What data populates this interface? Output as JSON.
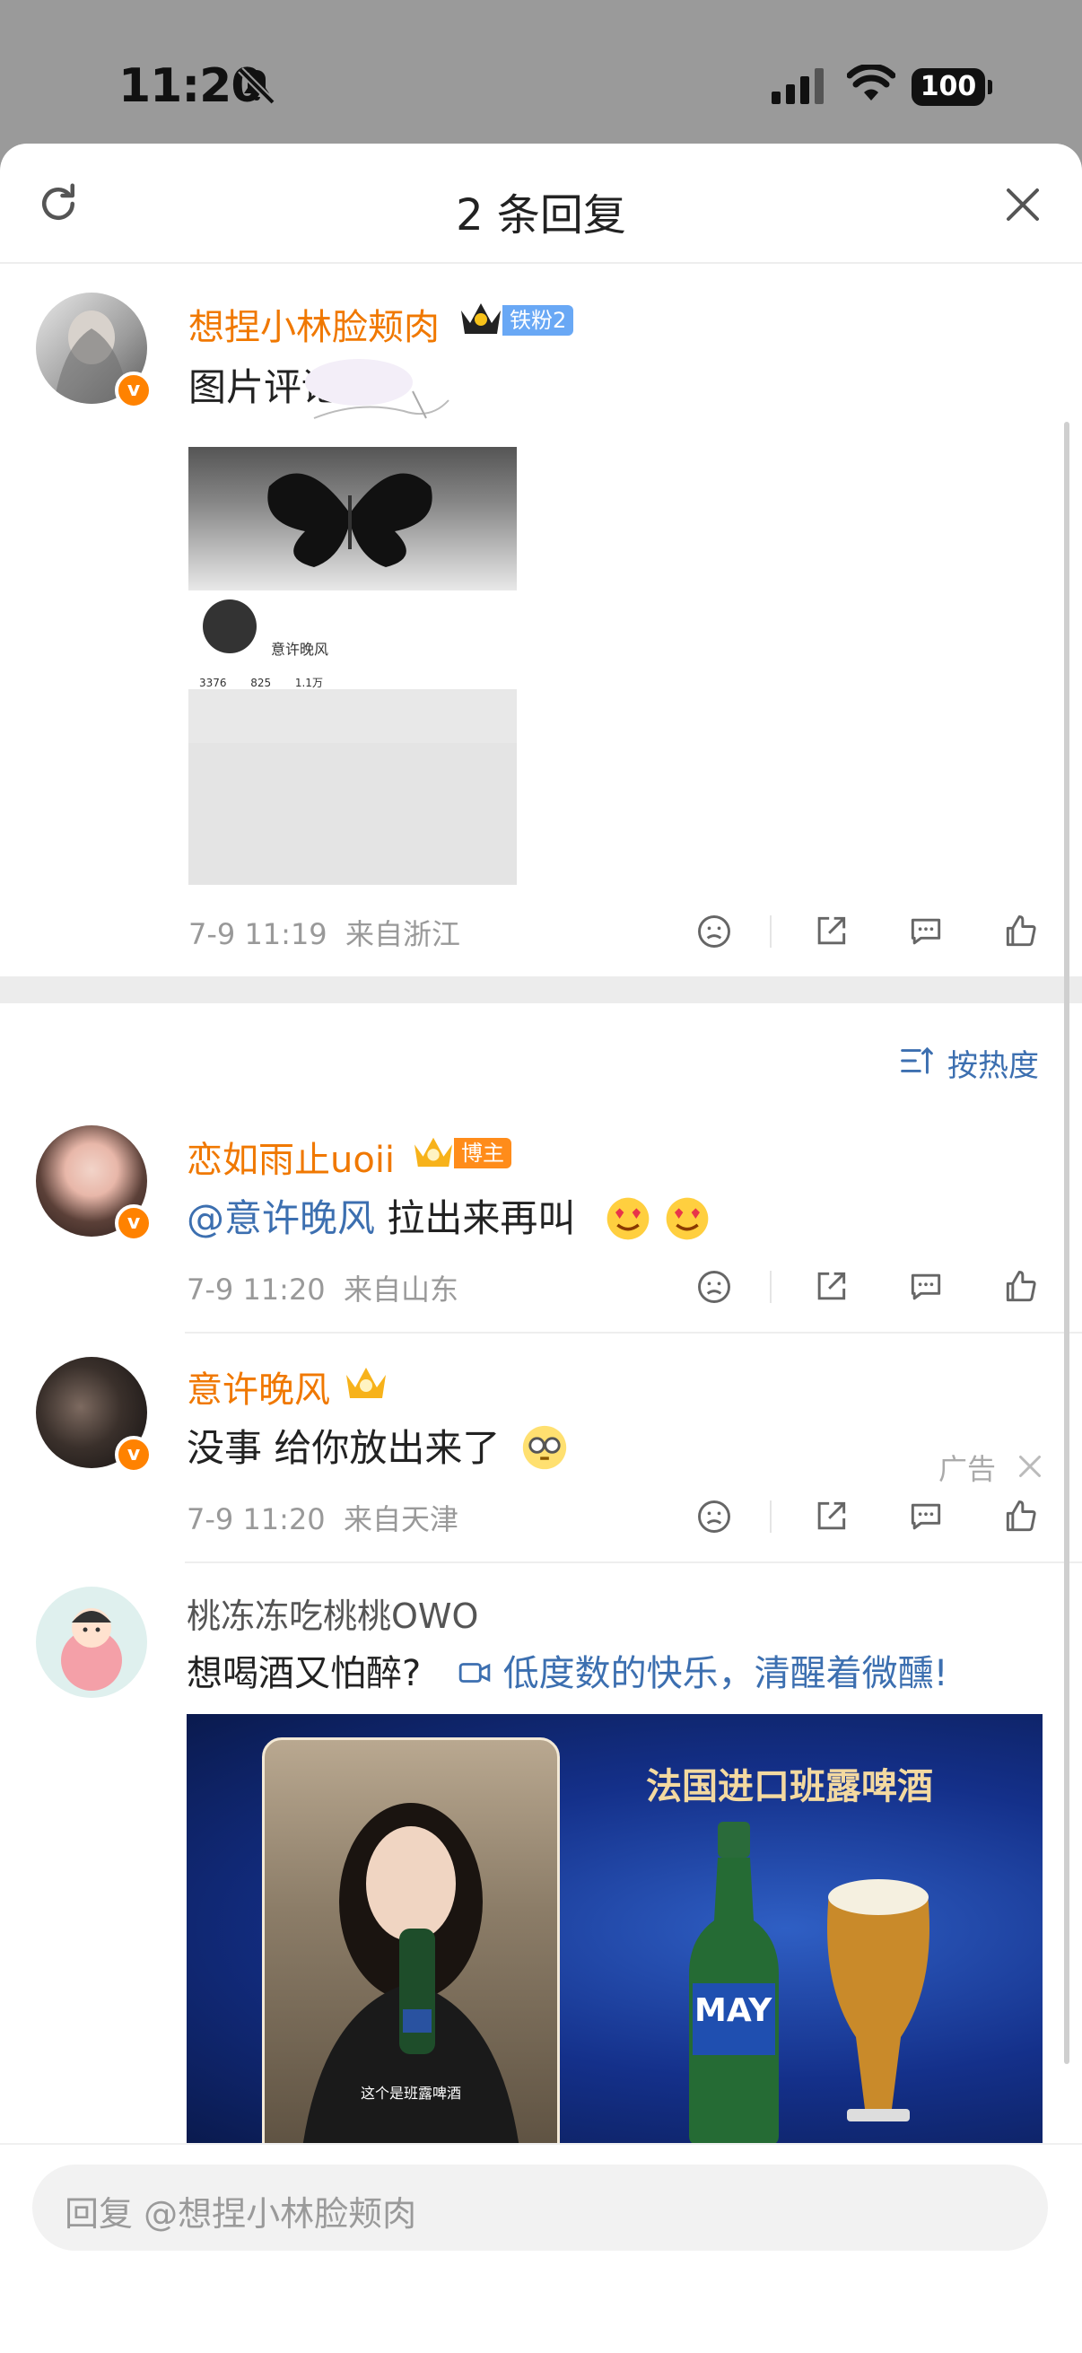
{
  "status_bar": {
    "time": "11:20",
    "battery": "100"
  },
  "header": {
    "title": "2 条回复"
  },
  "main_comment": {
    "username": "想捏小林脸颊肉",
    "fan_badge": "铁粉2",
    "text": "图片评论",
    "image_caption_name": "意许晚风",
    "image_stats": [
      "3376",
      "825",
      "1.1万"
    ],
    "time": "7-9 11:19",
    "location": "来自浙江"
  },
  "sort_label": "按热度",
  "replies": [
    {
      "username": "恋如雨止uoii",
      "badge": "博主",
      "mention": "@意许晚风",
      "text": " 拉出来再叫",
      "time": "7-9 11:20",
      "location": "来自山东"
    },
    {
      "username": "意许晚风",
      "text": "没事 给你放出来了",
      "time": "7-9 11:20",
      "location": "来自天津"
    }
  ],
  "ad": {
    "username": "桃冻冻吃桃桃OWO",
    "label": "广告",
    "text": "想喝酒又怕醉?",
    "link": "低度数的快乐，清醒着微醺!",
    "banner_title": "法国进口班露啤酒",
    "video_caption": "这个是班露啤酒",
    "bottle_brand": "MAY"
  },
  "reply_input": {
    "placeholder": "回复 @想捏小林脸颊肉"
  },
  "colors": {
    "orange_name": "#f07800",
    "link_blue": "#3c6fb0",
    "vip_badge": "#ff8200"
  }
}
